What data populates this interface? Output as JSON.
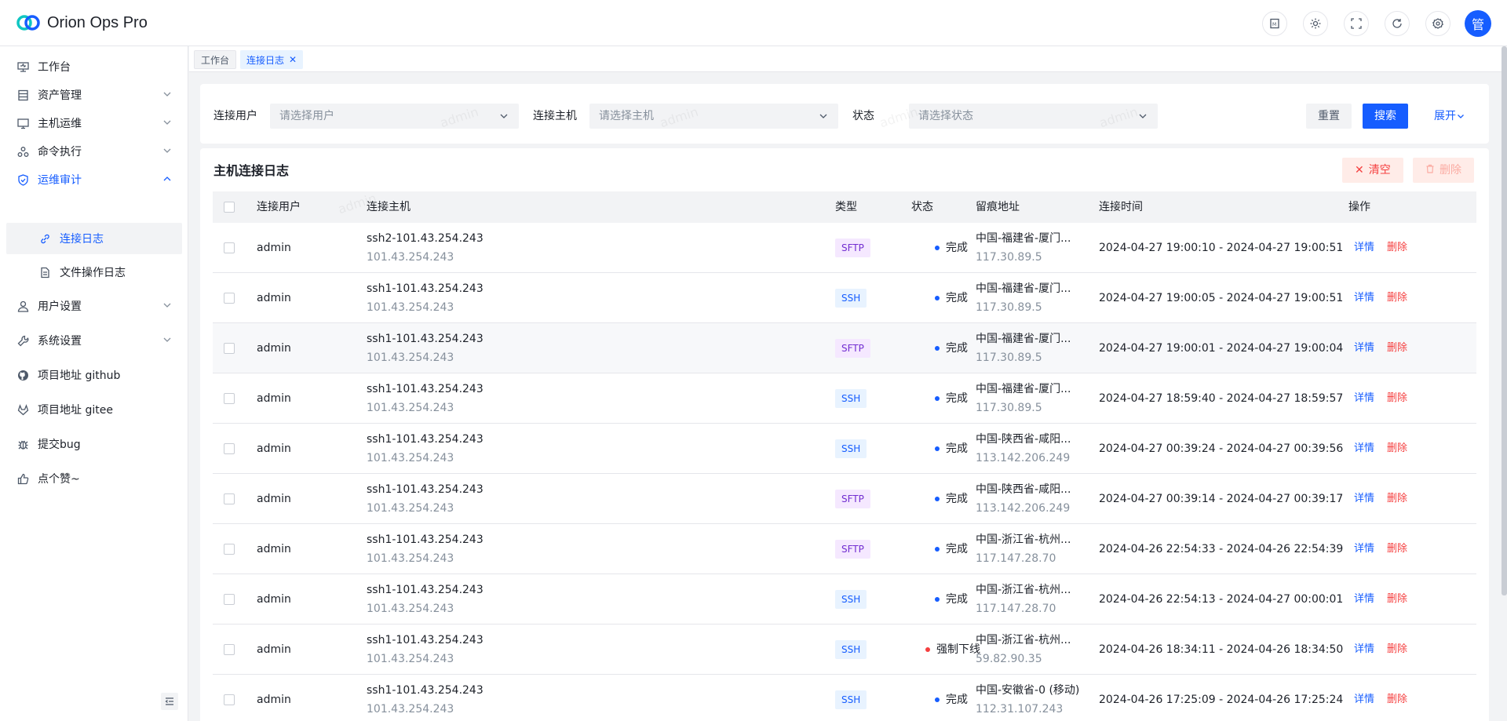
{
  "app": {
    "title": "Orion Ops Pro",
    "avatar_text": "管"
  },
  "header": {
    "icons": [
      "api-doc-icon",
      "theme-icon",
      "fullscreen-icon",
      "refresh-icon",
      "settings-icon"
    ]
  },
  "sidebar": {
    "items": [
      {
        "label": "工作台",
        "icon": "monitor-icon",
        "has_chevron": false
      },
      {
        "label": "资产管理",
        "icon": "storage-icon",
        "has_chevron": true
      },
      {
        "label": "主机运维",
        "icon": "desktop-icon",
        "has_chevron": true
      },
      {
        "label": "命令执行",
        "icon": "relation-icon",
        "has_chevron": true
      },
      {
        "label": "运维审计",
        "icon": "shield-icon",
        "has_chevron": true,
        "open": true
      },
      {
        "label": "连接日志",
        "icon": "link-icon",
        "sub": true,
        "active": true
      },
      {
        "label": "文件操作日志",
        "icon": "file-icon",
        "sub": true
      },
      {
        "label": "用户设置",
        "icon": "user-icon",
        "has_chevron": true
      },
      {
        "label": "系统设置",
        "icon": "tool-icon",
        "has_chevron": true
      },
      {
        "label": "项目地址 github",
        "icon": "github-icon"
      },
      {
        "label": "项目地址 gitee",
        "icon": "gitee-icon"
      },
      {
        "label": "提交bug",
        "icon": "bug-icon"
      },
      {
        "label": "点个赞~",
        "icon": "thumb-up-icon"
      }
    ]
  },
  "tabs": {
    "home": "工作台",
    "current": "连接日志"
  },
  "filter": {
    "user_label": "连接用户",
    "user_placeholder": "请选择用户",
    "host_label": "连接主机",
    "host_placeholder": "请选择主机",
    "status_label": "状态",
    "status_placeholder": "请选择状态",
    "reset": "重置",
    "search": "搜索",
    "expand": "展开"
  },
  "table_card": {
    "title": "主机连接日志",
    "clear": "清空",
    "delete": "删除",
    "columns": [
      "连接用户",
      "连接主机",
      "类型",
      "状态",
      "留痕地址",
      "连接时间",
      "操作"
    ],
    "op_detail": "详情",
    "op_delete": "删除",
    "rows": [
      {
        "user": "admin",
        "host": "ssh2-101.43.254.243",
        "ip": "101.43.254.243",
        "type": "SFTP",
        "status": "完成",
        "addr": "中国-福建省-厦门...",
        "addr_ip": "117.30.89.5",
        "time": "2024-04-27 19:00:10 - 2024-04-27 19:00:51"
      },
      {
        "user": "admin",
        "host": "ssh1-101.43.254.243",
        "ip": "101.43.254.243",
        "type": "SSH",
        "status": "完成",
        "addr": "中国-福建省-厦门...",
        "addr_ip": "117.30.89.5",
        "time": "2024-04-27 19:00:05 - 2024-04-27 19:00:51"
      },
      {
        "user": "admin",
        "host": "ssh1-101.43.254.243",
        "ip": "101.43.254.243",
        "type": "SFTP",
        "status": "完成",
        "addr": "中国-福建省-厦门...",
        "addr_ip": "117.30.89.5",
        "time": "2024-04-27 19:00:01 - 2024-04-27 19:00:04"
      },
      {
        "user": "admin",
        "host": "ssh1-101.43.254.243",
        "ip": "101.43.254.243",
        "type": "SSH",
        "status": "完成",
        "addr": "中国-福建省-厦门...",
        "addr_ip": "117.30.89.5",
        "time": "2024-04-27 18:59:40 - 2024-04-27 18:59:57"
      },
      {
        "user": "admin",
        "host": "ssh1-101.43.254.243",
        "ip": "101.43.254.243",
        "type": "SSH",
        "status": "完成",
        "addr": "中国-陕西省-咸阳...",
        "addr_ip": "113.142.206.249",
        "time": "2024-04-27 00:39:24 - 2024-04-27 00:39:56"
      },
      {
        "user": "admin",
        "host": "ssh1-101.43.254.243",
        "ip": "101.43.254.243",
        "type": "SFTP",
        "status": "完成",
        "addr": "中国-陕西省-咸阳...",
        "addr_ip": "113.142.206.249",
        "time": "2024-04-27 00:39:14 - 2024-04-27 00:39:17"
      },
      {
        "user": "admin",
        "host": "ssh1-101.43.254.243",
        "ip": "101.43.254.243",
        "type": "SFTP",
        "status": "完成",
        "addr": "中国-浙江省-杭州...",
        "addr_ip": "117.147.28.70",
        "time": "2024-04-26 22:54:33 - 2024-04-26 22:54:39"
      },
      {
        "user": "admin",
        "host": "ssh1-101.43.254.243",
        "ip": "101.43.254.243",
        "type": "SSH",
        "status": "完成",
        "addr": "中国-浙江省-杭州...",
        "addr_ip": "117.147.28.70",
        "time": "2024-04-26 22:54:13 - 2024-04-27 00:00:01"
      },
      {
        "user": "admin",
        "host": "ssh1-101.43.254.243",
        "ip": "101.43.254.243",
        "type": "SSH",
        "status": "强制下线",
        "addr": "中国-浙江省-杭州...",
        "addr_ip": "59.82.90.35",
        "time": "2024-04-26 18:34:11 - 2024-04-26 18:34:50"
      },
      {
        "user": "admin",
        "host": "ssh1-101.43.254.243",
        "ip": "101.43.254.243",
        "type": "SSH",
        "status": "完成",
        "addr": "中国-安徽省-0 (移动)",
        "addr_ip": "112.31.107.243",
        "time": "2024-04-26 17:25:09 - 2024-04-26 17:25:24"
      }
    ]
  },
  "watermark": "admin",
  "colors": {
    "primary": "#165dff",
    "danger": "#f53f3f",
    "status_ok": "#165dff",
    "status_forced": "#f53f3f",
    "sftp": "#722ed1"
  }
}
